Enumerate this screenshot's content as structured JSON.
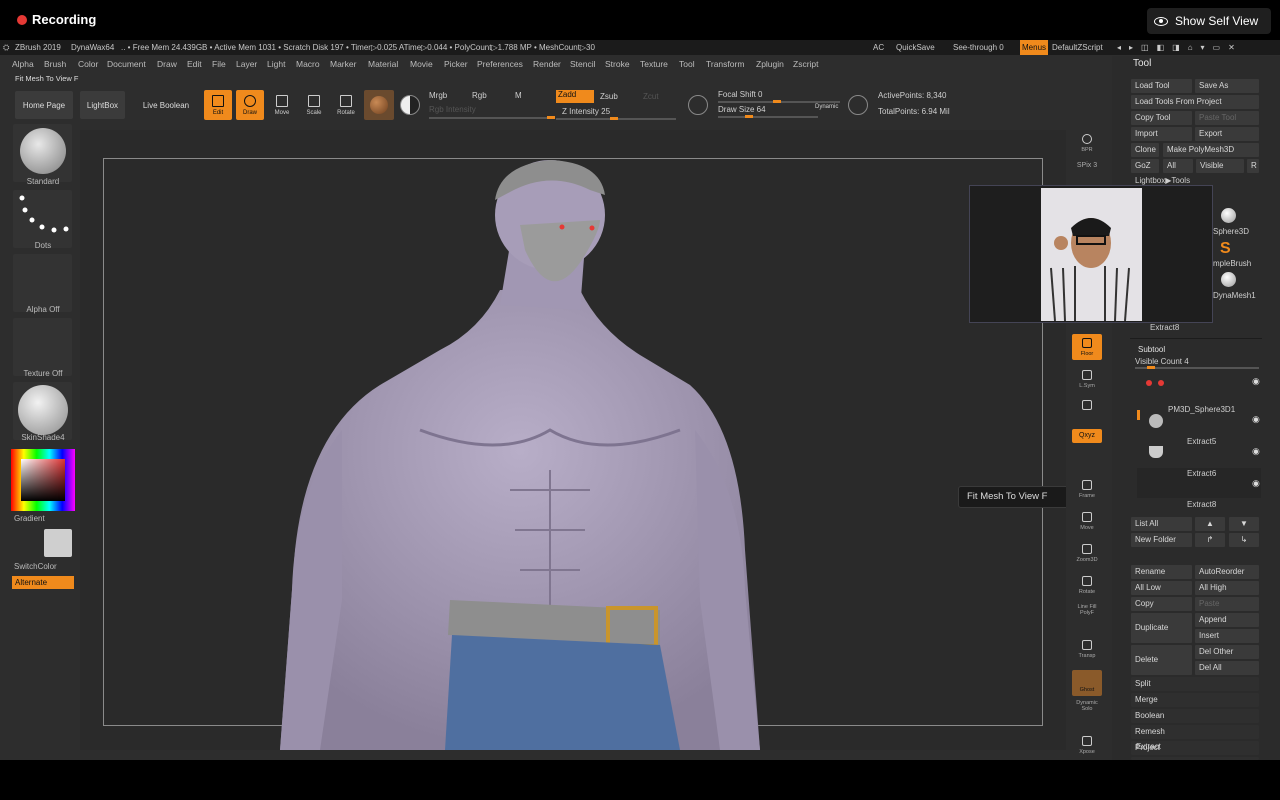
{
  "recording": {
    "label": "Recording",
    "self_view_label": "Show Self View"
  },
  "titlebar": {
    "app": "ZBrush 2019",
    "dynawax": "DynaWax64",
    "stats": ".. • Free Mem 24.439GB • Active Mem 1031 • Scratch Disk 197 •  Timer▷0.025 ATime▷0.044 • PolyCount▷1.788 MP  • MeshCount▷30",
    "ac": "AC",
    "quicksave": "QuickSave",
    "seethrough": "See-through  0",
    "menus": "Menus",
    "script": "DefaultZScript"
  },
  "menubar": [
    "Alpha",
    "Brush",
    "Color",
    "Document",
    "Draw",
    "Edit",
    "File",
    "Layer",
    "Light",
    "Macro",
    "Marker",
    "Material",
    "Movie",
    "Picker",
    "Preferences",
    "Render",
    "Stencil",
    "Stroke",
    "Texture",
    "Tool",
    "Transform",
    "Zplugin",
    "Zscript"
  ],
  "fit_mesh_top": "Fit Mesh To View F",
  "toolbar": {
    "home": "Home Page",
    "lightbox": "LightBox",
    "live_boolean": "Live Boolean",
    "edit": "Edit",
    "draw": "Draw",
    "move": "Move",
    "scale": "Scale",
    "rotate": "Rotate",
    "mrgb": "Mrgb",
    "rgb": "Rgb",
    "m": "M",
    "rgb_intensity": "Rgb Intensity",
    "zadd": "Zadd",
    "zsub": "Zsub",
    "zcut": "Zcut",
    "z_intensity": "Z Intensity 25",
    "focal_shift": "Focal Shift 0",
    "draw_size": "Draw Size 64",
    "dynamic": "Dynamic",
    "active_points": "ActivePoints: 8,340",
    "total_points": "TotalPoints: 6.94 Mil"
  },
  "left_shelf": {
    "brush": "Standard",
    "stroke": "Dots",
    "alpha": "Alpha Off",
    "texture": "Texture Off",
    "material": "SkinShade4",
    "gradient": "Gradient",
    "switchcolor": "SwitchColor",
    "alternate": "Alternate"
  },
  "right_shelf": {
    "bpr": "BPR",
    "spix": "SPix 3",
    "floor": "Floor",
    "lsym": "L.Sym",
    "xyz": "Qxyz",
    "frame": "Frame",
    "move": "Move",
    "zoom3d": "Zoom3D",
    "rotate": "Rotate",
    "linefill": "Line Fill",
    "polyf": "PolyF",
    "transp": "Transp",
    "ghost": "Ghost",
    "dynamic": "Dynamic",
    "solo": "Solo",
    "xpose": "Xpose"
  },
  "tooltip": "Fit Mesh To View  F",
  "tool_palette": {
    "title": "Tool",
    "load_tool": "Load Tool",
    "save_as": "Save As",
    "load_from_project": "Load Tools From Project",
    "copy_tool": "Copy Tool",
    "paste_tool": "Paste Tool",
    "import": "Import",
    "export": "Export",
    "clone": "Clone",
    "make_polymesh": "Make PolyMesh3D",
    "goz": "GoZ",
    "all": "All",
    "visible": "Visible",
    "r": "R",
    "lightbox_tools": "Lightbox▶Tools",
    "thumb_sphere": "Sphere3D",
    "thumb_simple": "mpleBrush",
    "thumb_dyna": "DynaMesh1",
    "extract8_top": "Extract8",
    "subtool": "Subtool",
    "visible_count": "Visible Count 4",
    "subtools": [
      "PM3D_Sphere3D1",
      "Extract5",
      "Extract6",
      "Extract8"
    ],
    "list_all": "List All",
    "new_folder": "New Folder",
    "rename": "Rename",
    "autoreorder": "AutoReorder",
    "all_low": "All Low",
    "all_high": "All High",
    "copy": "Copy",
    "paste": "Paste",
    "duplicate": "Duplicate",
    "append": "Append",
    "insert": "Insert",
    "delete": "Delete",
    "del_other": "Del Other",
    "del_all": "Del All",
    "split": "Split",
    "merge": "Merge",
    "boolean": "Boolean",
    "remesh": "Remesh",
    "project": "Project",
    "extract": "Extract"
  },
  "colors": {
    "accent": "#f08a1c",
    "skin": "#a99fb8",
    "pants": "#4f6fa0",
    "belt": "#8e8e8e",
    "buckle": "#c9952c"
  }
}
